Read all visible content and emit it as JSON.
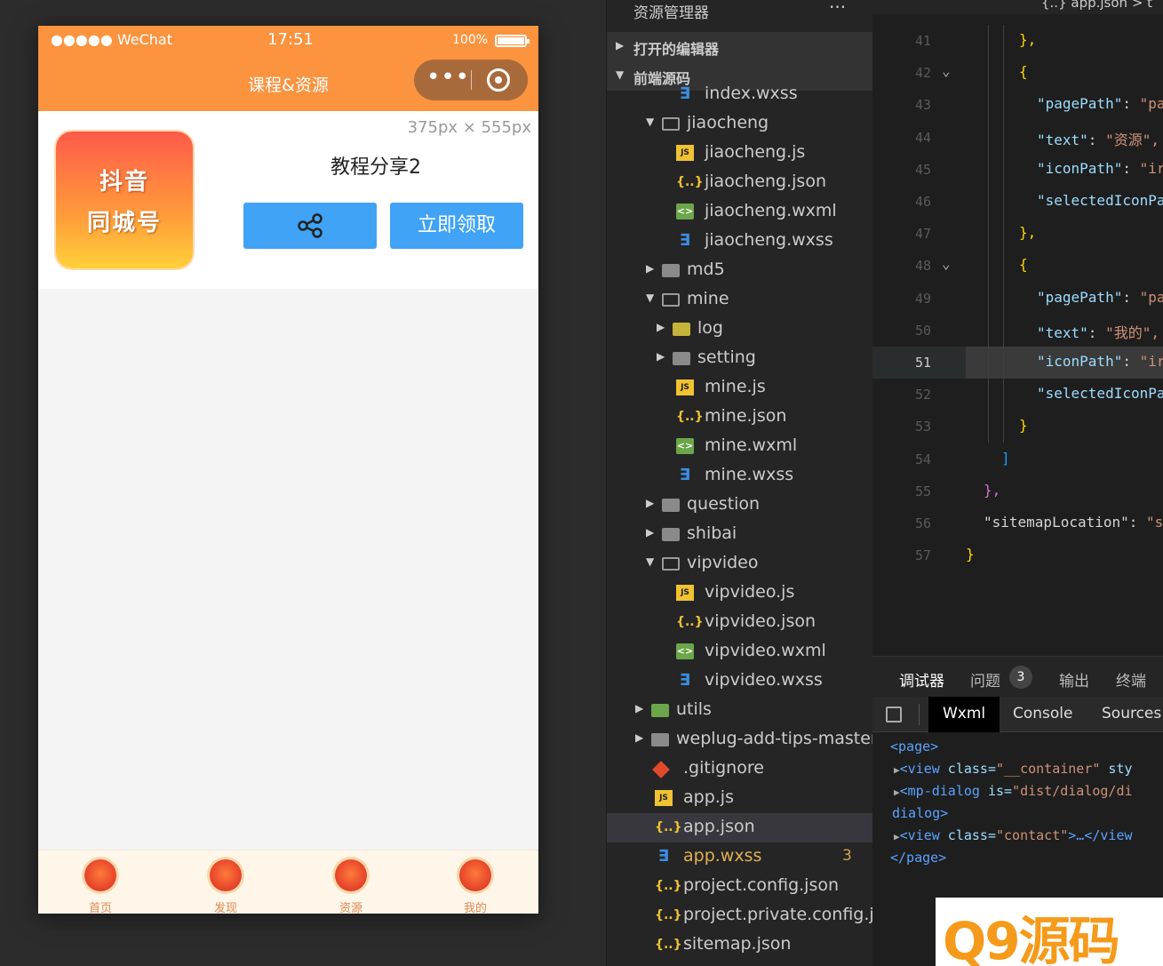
{
  "phone": {
    "status": {
      "carrier": "●●●●● WeChat",
      "time": "17:51",
      "battery": "100%"
    },
    "nav_title": "课程&资源",
    "capsule_dots": "•••",
    "size_hint": "375px × 555px",
    "card": {
      "thumb_line1": "抖音",
      "thumb_line2": "同城号",
      "title": "教程分享2",
      "claim_label": "立即领取"
    },
    "tabs": [
      {
        "label": "首页"
      },
      {
        "label": "发现"
      },
      {
        "label": "资源"
      },
      {
        "label": "我的"
      }
    ]
  },
  "explorer": {
    "title": "资源管理器",
    "more": "···",
    "sections": {
      "open_editors": "打开的编辑器",
      "source": "前端源码"
    },
    "rows": [
      {
        "name": "index.wxss",
        "type": "wxss"
      },
      {
        "name": "jiaocheng",
        "type": "folder-open"
      },
      {
        "name": "jiaocheng.js",
        "type": "js"
      },
      {
        "name": "jiaocheng.json",
        "type": "json"
      },
      {
        "name": "jiaocheng.wxml",
        "type": "wxml"
      },
      {
        "name": "jiaocheng.wxss",
        "type": "wxss"
      },
      {
        "name": "md5",
        "type": "folder"
      },
      {
        "name": "mine",
        "type": "folder-open"
      },
      {
        "name": "log",
        "type": "folder-log"
      },
      {
        "name": "setting",
        "type": "folder"
      },
      {
        "name": "mine.js",
        "type": "js"
      },
      {
        "name": "mine.json",
        "type": "json"
      },
      {
        "name": "mine.wxml",
        "type": "wxml"
      },
      {
        "name": "mine.wxss",
        "type": "wxss"
      },
      {
        "name": "question",
        "type": "folder"
      },
      {
        "name": "shibai",
        "type": "folder"
      },
      {
        "name": "vipvideo",
        "type": "folder-open"
      },
      {
        "name": "vipvideo.js",
        "type": "js"
      },
      {
        "name": "vipvideo.json",
        "type": "json"
      },
      {
        "name": "vipvideo.wxml",
        "type": "wxml"
      },
      {
        "name": "vipvideo.wxss",
        "type": "wxss"
      },
      {
        "name": "utils",
        "type": "folder-utils"
      },
      {
        "name": "weplug-add-tips-master",
        "type": "folder"
      },
      {
        "name": ".gitignore",
        "type": "git"
      },
      {
        "name": "app.js",
        "type": "js"
      },
      {
        "name": "app.json",
        "type": "json",
        "selected": true
      },
      {
        "name": "app.wxss",
        "type": "wxss",
        "badge": "3"
      },
      {
        "name": "project.config.json",
        "type": "json"
      },
      {
        "name": "project.private.config.js...",
        "type": "json"
      },
      {
        "name": "sitemap.json",
        "type": "json"
      }
    ]
  },
  "editor": {
    "tab": "{..} app.json > t",
    "lines": [
      {
        "n": "41",
        "code": "},"
      },
      {
        "n": "42",
        "code": "{"
      },
      {
        "n": "43",
        "key": "\"pagePath\"",
        "val": "\"pa"
      },
      {
        "n": "44",
        "key": "\"text\"",
        "val": "\"资源\","
      },
      {
        "n": "45",
        "key": "\"iconPath\"",
        "val": "\"ir"
      },
      {
        "n": "46",
        "key": "\"selectedIconPa"
      },
      {
        "n": "47",
        "code": "},"
      },
      {
        "n": "48",
        "code": "{"
      },
      {
        "n": "49",
        "key": "\"pagePath\"",
        "val": "\"pa"
      },
      {
        "n": "50",
        "key": "\"text\"",
        "val": "\"我的\","
      },
      {
        "n": "51",
        "key": "\"iconPath\"",
        "val": "\"ir"
      },
      {
        "n": "52",
        "key": "\"selectedIconPa"
      },
      {
        "n": "53",
        "code": "}"
      },
      {
        "n": "54",
        "code": "]"
      },
      {
        "n": "55",
        "code": "},"
      },
      {
        "n": "56",
        "key": "\"sitemapLocation\"",
        "val": "\"s"
      },
      {
        "n": "57",
        "code": "}"
      }
    ]
  },
  "debug": {
    "tabs": {
      "debugger": "调试器",
      "issues": "问题",
      "issues_count": "3",
      "output": "输出",
      "terminal": "终端"
    },
    "sub_tabs": {
      "wxml": "Wxml",
      "console": "Console",
      "sources": "Sources"
    },
    "xml": {
      "l1": "<page>",
      "l2_tag": "<view",
      "l2_attr": " class=",
      "l2_val": "\"__container\"",
      "l2_rest": " sty",
      "l3_tag": "<mp-dialog",
      "l3_attr": " is=",
      "l3_val": "\"dist/dialog/di",
      "l4": "dialog>",
      "l5_tag": "<view",
      "l5_attr": " class=",
      "l5_val": "\"contact\"",
      "l5_rest": ">…</view",
      "l6": "</page>"
    }
  },
  "watermark": "Q9源码"
}
